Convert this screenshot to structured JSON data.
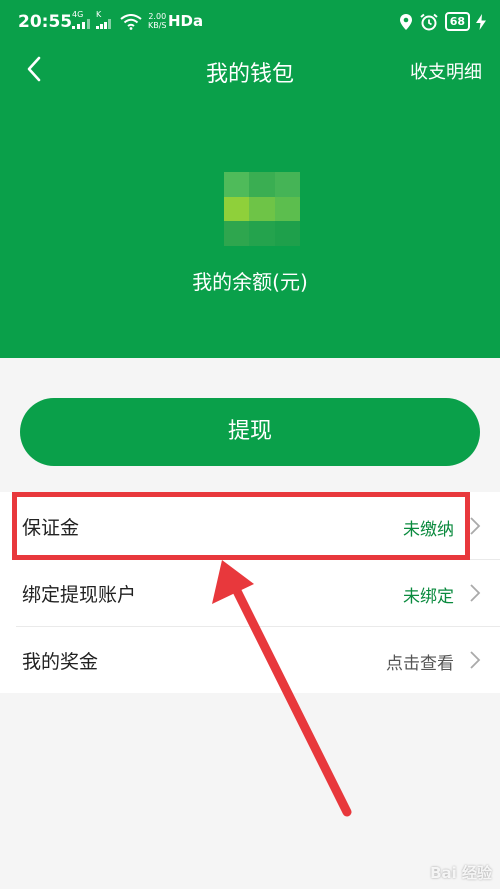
{
  "statusbar": {
    "time": "20:55",
    "signal1": "4G",
    "signal2": "K",
    "net_speed_value": "2.00",
    "net_speed_unit": "KB/S",
    "hd_label": "HDa",
    "battery": "68"
  },
  "nav": {
    "title": "我的钱包",
    "detail_link": "收支明细"
  },
  "balance": {
    "label": "我的余额(元)"
  },
  "withdraw_button": "提现",
  "list": [
    {
      "label": "保证金",
      "status": "未缴纳"
    },
    {
      "label": "绑定提现账户",
      "status": "未绑定"
    },
    {
      "label": "我的奖金",
      "status": "点击查看"
    }
  ],
  "colors": {
    "brand_green": "#0aa04a",
    "status_green": "#0a8a3e",
    "status_gray": "#555555",
    "highlight_red": "#e8383c"
  },
  "watermark": "Bai 经验"
}
